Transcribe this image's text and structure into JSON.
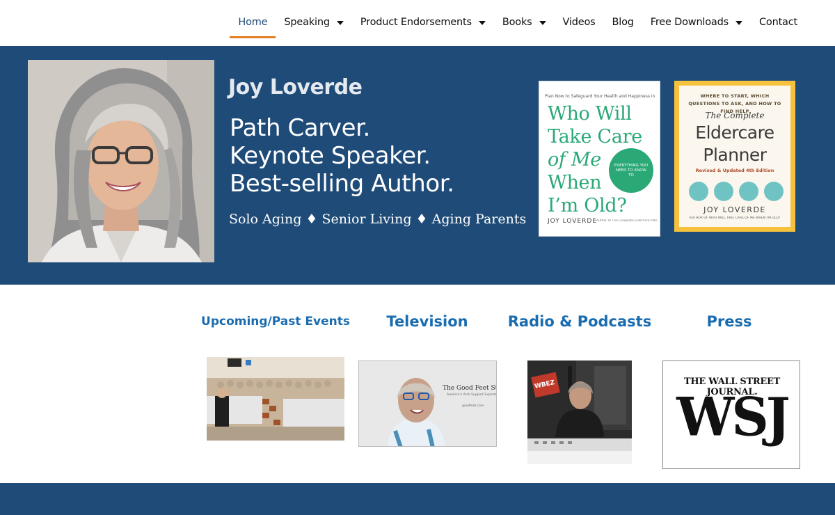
{
  "nav": {
    "items": [
      {
        "label": "Home",
        "active": true,
        "dropdown": false
      },
      {
        "label": "Speaking",
        "active": false,
        "dropdown": true
      },
      {
        "label": "Product Endorsements",
        "active": false,
        "dropdown": true
      },
      {
        "label": "Books",
        "active": false,
        "dropdown": true
      },
      {
        "label": "Videos",
        "active": false,
        "dropdown": false
      },
      {
        "label": "Blog",
        "active": false,
        "dropdown": false
      },
      {
        "label": "Free Downloads",
        "active": false,
        "dropdown": true
      },
      {
        "label": "Contact",
        "active": false,
        "dropdown": false
      }
    ]
  },
  "hero": {
    "name": "Joy Loverde",
    "tagline": [
      "Path Carver.",
      "Keynote Speaker.",
      "Best-selling Author."
    ],
    "topics": "Solo Aging ♦ Senior Living ♦ Aging Parents"
  },
  "books": {
    "book1": {
      "kicker": "Plan Now to Safeguard Your Health and Happiness in Old Age",
      "title_lines": [
        "Who Will",
        "Take Care",
        "of Me",
        "When",
        "I’m Old?"
      ],
      "badge": "EVERYTHING YOU NEED TO KNOW TO",
      "author": "JOY LOVERDE",
      "author_note": "Author of The Complete Eldercare Planner"
    },
    "book2": {
      "kicker": "WHERE TO START, WHICH QUESTIONS TO ASK, AND HOW TO FIND HELP",
      "subtitle": "The Complete",
      "title_lines": [
        "Eldercare",
        "Planner"
      ],
      "edition": "Revised & Updated 4th Edition",
      "author": "JOY LOVERDE",
      "author_note": "AUTHOR OF WHO WILL TAKE CARE OF ME WHEN I'M OLD?"
    }
  },
  "media": {
    "events": {
      "label": "Upcoming/Past Events"
    },
    "television": {
      "label": "Television",
      "sign_title": "The Good Feet Store",
      "sign_sub": "America's Arch Support Experts",
      "sign_url": "goodfeet.com"
    },
    "radio": {
      "label": "Radio & Podcasts",
      "sign": "WBEZ"
    },
    "press": {
      "label": "Press",
      "masthead": "THE WALL STREET JOURNAL.",
      "logo": "WSJ"
    }
  },
  "colors": {
    "brand_blue": "#1f4b78",
    "accent_orange": "#e67e22",
    "link_blue": "#1a6cb0",
    "book_green": "#2aa876",
    "book2_gold": "#f6c23e"
  }
}
